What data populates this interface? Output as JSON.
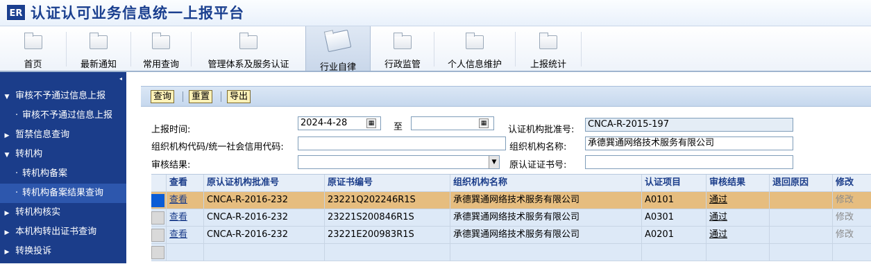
{
  "app": {
    "logo": "ER",
    "title": "认证认可业务信息统一上报平台"
  },
  "nav": {
    "items": [
      {
        "label": "首页"
      },
      {
        "label": "最新通知"
      },
      {
        "label": "常用查询"
      },
      {
        "label": "管理体系及服务认证"
      },
      {
        "label": "行业自律"
      },
      {
        "label": "行政监管"
      },
      {
        "label": "个人信息维护"
      },
      {
        "label": "上报统计"
      }
    ],
    "active": "行业自律"
  },
  "sidebar": {
    "collapse_icon": "◂",
    "items": [
      {
        "label": "审核不予通过信息上报",
        "expanded": true
      },
      {
        "label": "审核不予通过信息上报"
      },
      {
        "label": "暂禁信息查询"
      },
      {
        "label": "转机构",
        "expanded": true
      },
      {
        "label": "转机构备案"
      },
      {
        "label": "转机构备案结果查询",
        "active": true
      },
      {
        "label": "转机构核实"
      },
      {
        "label": "本机构转出证书查询"
      },
      {
        "label": "转换投诉"
      }
    ]
  },
  "toolbar": {
    "query": "查询",
    "reset": "重置",
    "export": "导出"
  },
  "form": {
    "report_time_label": "上报时间:",
    "report_time_from": "2024-4-28",
    "to_label": "至",
    "report_time_to": "",
    "cert_body_approval_label": "认证机构批准号:",
    "cert_body_approval": "CNCA-R-2015-197",
    "org_code_label": "组织机构代码/统一社会信用代码:",
    "org_code": "",
    "org_name_label": "组织机构名称:",
    "org_name": "承德巽通网络技术服务有限公司",
    "review_result_label": "审核结果:",
    "review_result": "",
    "orig_cert_no_label": "原认证证书号:",
    "orig_cert_no": ""
  },
  "grid": {
    "columns": [
      "查看",
      "原认证机构批准号",
      "原证书编号",
      "组织机构名称",
      "认证项目",
      "审核结果",
      "退回原因",
      "修改"
    ],
    "rows": [
      {
        "view": "查看",
        "orig_approval": "CNCA-R-2016-232",
        "cert_no": "23221Q202246R1S",
        "org": "承德巽通网络技术服务有限公司",
        "project": "A0101",
        "result": "通过",
        "reason": "",
        "edit": "修改"
      },
      {
        "view": "查看",
        "orig_approval": "CNCA-R-2016-232",
        "cert_no": "23221S200846R1S",
        "org": "承德巽通网络技术服务有限公司",
        "project": "A0301",
        "result": "通过",
        "reason": "",
        "edit": "修改"
      },
      {
        "view": "查看",
        "orig_approval": "CNCA-R-2016-232",
        "cert_no": "23221E200983R1S",
        "org": "承德巽通网络技术服务有限公司",
        "project": "A0201",
        "result": "通过",
        "reason": "",
        "edit": "修改"
      }
    ]
  }
}
